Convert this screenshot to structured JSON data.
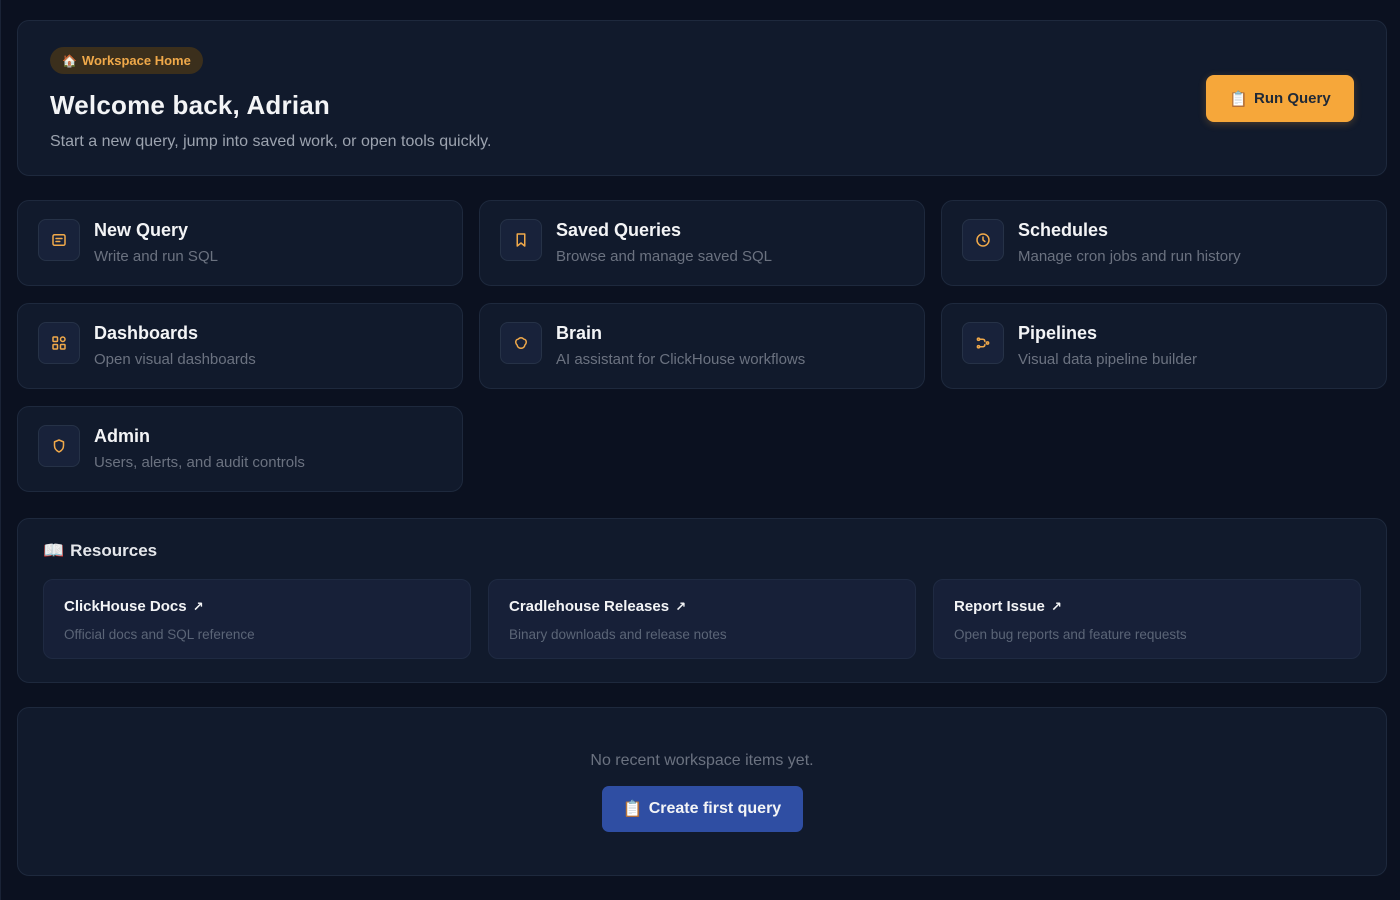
{
  "hero": {
    "badge_icon": "🏠",
    "badge_label": "Workspace Home",
    "title": "Welcome back, Adrian",
    "subtitle": "Start a new query, jump into saved work, or open tools quickly.",
    "run_button_icon": "📋",
    "run_button_label": "Run Query"
  },
  "tiles": [
    {
      "title": "New Query",
      "desc": "Write and run SQL",
      "icon": "sql-editor-icon"
    },
    {
      "title": "Saved Queries",
      "desc": "Browse and manage saved SQL",
      "icon": "bookmark-icon"
    },
    {
      "title": "Schedules",
      "desc": "Manage cron jobs and run history",
      "icon": "clock-icon"
    },
    {
      "title": "Dashboards",
      "desc": "Open visual dashboards",
      "icon": "grid-icon"
    },
    {
      "title": "Brain",
      "desc": "AI assistant for ClickHouse workflows",
      "icon": "brain-icon"
    },
    {
      "title": "Pipelines",
      "desc": "Visual data pipeline builder",
      "icon": "pipeline-icon"
    },
    {
      "title": "Admin",
      "desc": "Users, alerts, and audit controls",
      "icon": "shield-icon"
    }
  ],
  "resources": {
    "heading_icon": "📖",
    "heading": "Resources",
    "items": [
      {
        "title": "ClickHouse Docs",
        "desc": "Official docs and SQL reference",
        "arrow": "↗"
      },
      {
        "title": "Cradlehouse Releases",
        "desc": "Binary downloads and release notes",
        "arrow": "↗"
      },
      {
        "title": "Report Issue",
        "desc": "Open bug reports and feature requests",
        "arrow": "↗"
      }
    ]
  },
  "empty": {
    "text": "No recent workspace items yet.",
    "button_icon": "📋",
    "button_label": "Create first query"
  },
  "colors": {
    "accent": "#f6a73a",
    "primary_button": "#2f4ea3",
    "background": "#0b1120"
  }
}
